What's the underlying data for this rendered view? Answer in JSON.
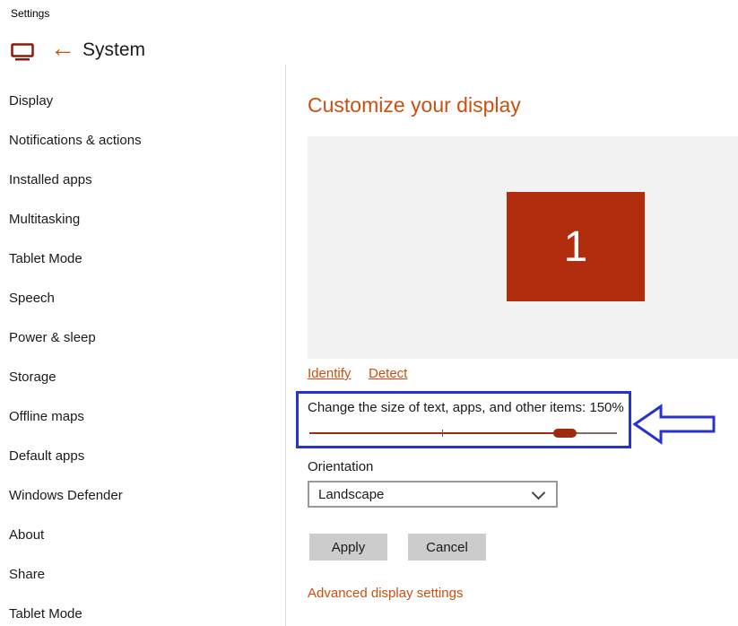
{
  "titlebar": {
    "title": "Settings"
  },
  "header": {
    "title": "System",
    "back_glyph": "←"
  },
  "sidebar": {
    "items": [
      "Display",
      "Notifications & actions",
      "Installed apps",
      "Multitasking",
      "Tablet Mode",
      "Speech",
      "Power & sleep",
      "Storage",
      "Offline maps",
      "Default apps",
      "Windows Defender",
      "About",
      "Share",
      "Tablet Mode"
    ]
  },
  "main": {
    "heading": "Customize your display",
    "preview": {
      "monitor_label": "1"
    },
    "identify_link": "Identify",
    "detect_link": "Detect",
    "scaling": {
      "label": "Change the size of text, apps, and other items: 150%",
      "value_percent": 150
    },
    "orientation": {
      "label": "Orientation",
      "value": "Landscape"
    },
    "apply_label": "Apply",
    "cancel_label": "Cancel",
    "advanced_link": "Advanced display settings"
  },
  "colors": {
    "accent": "#CA5010",
    "monitor_red": "#B22D0E",
    "slider_red": "#9E2B0E",
    "annotation_blue": "#2633CC",
    "panel_gray": "#F2F2F2",
    "button_gray": "#CCCCCC"
  },
  "icons": {
    "monitor-icon": "laptop-display-outline",
    "back-arrow-icon": "←",
    "chevron-down-icon": "v",
    "annotation-arrow-icon": "hollow-left-arrow"
  }
}
